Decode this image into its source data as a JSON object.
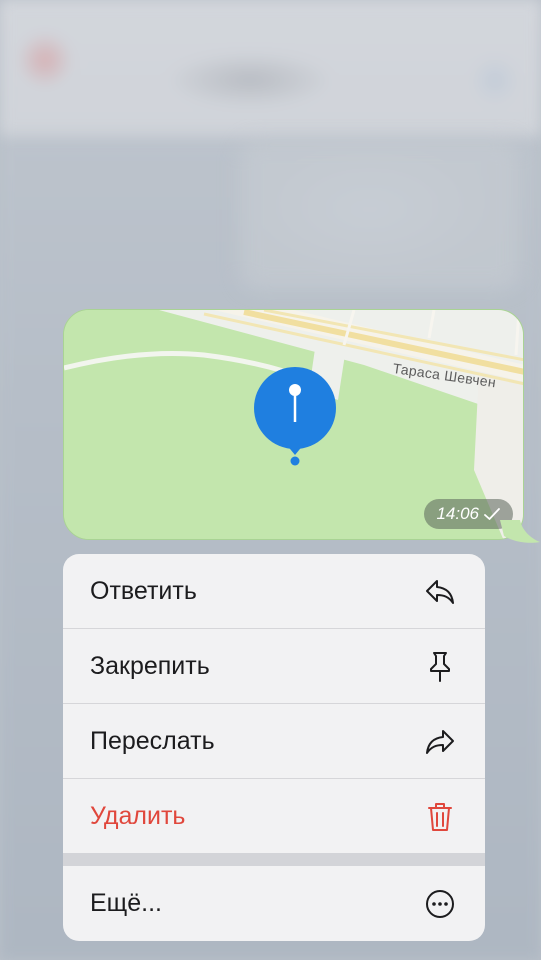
{
  "map": {
    "street_name": "Тараса Шевчен",
    "timestamp": "14:06",
    "status_icon": "checkmark-icon",
    "colors": {
      "park": "#c3e6ad",
      "road": "#f6f3ea",
      "road_yellow": "#f4e3a3",
      "pin": "#1f7fe0"
    }
  },
  "menu": {
    "items": [
      {
        "label": "Ответить",
        "icon": "reply-icon"
      },
      {
        "label": "Закрепить",
        "icon": "pin-icon"
      },
      {
        "label": "Переслать",
        "icon": "forward-icon"
      },
      {
        "label": "Удалить",
        "icon": "trash-icon",
        "destructive": true,
        "color": "#e0473c"
      }
    ],
    "more": {
      "label": "Ещё...",
      "icon": "more-icon"
    }
  }
}
